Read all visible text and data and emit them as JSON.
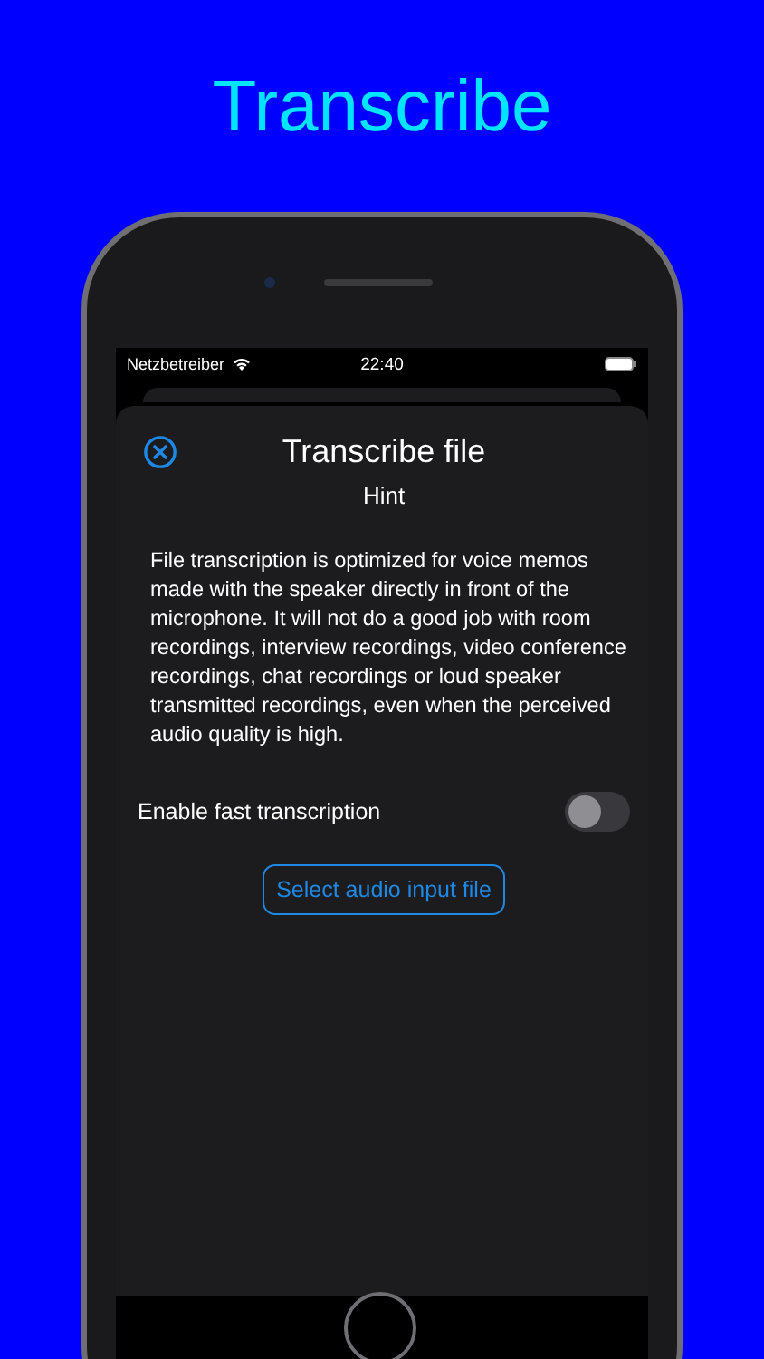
{
  "headline": "Transcribe",
  "status_bar": {
    "carrier": "Netzbetreiber",
    "time": "22:40"
  },
  "sheet": {
    "title": "Transcribe file",
    "subtitle": "Hint",
    "body": "File transcription is optimized for voice memos made with the speaker directly in front of the microphone. It will not do a good job with room recordings, interview recordings, video conference recordings, chat recordings or loud speaker transmitted recordings, even when the perceived audio quality is high.",
    "toggle": {
      "label": "Enable fast transcription",
      "on": false
    },
    "button": "Select audio input file"
  }
}
